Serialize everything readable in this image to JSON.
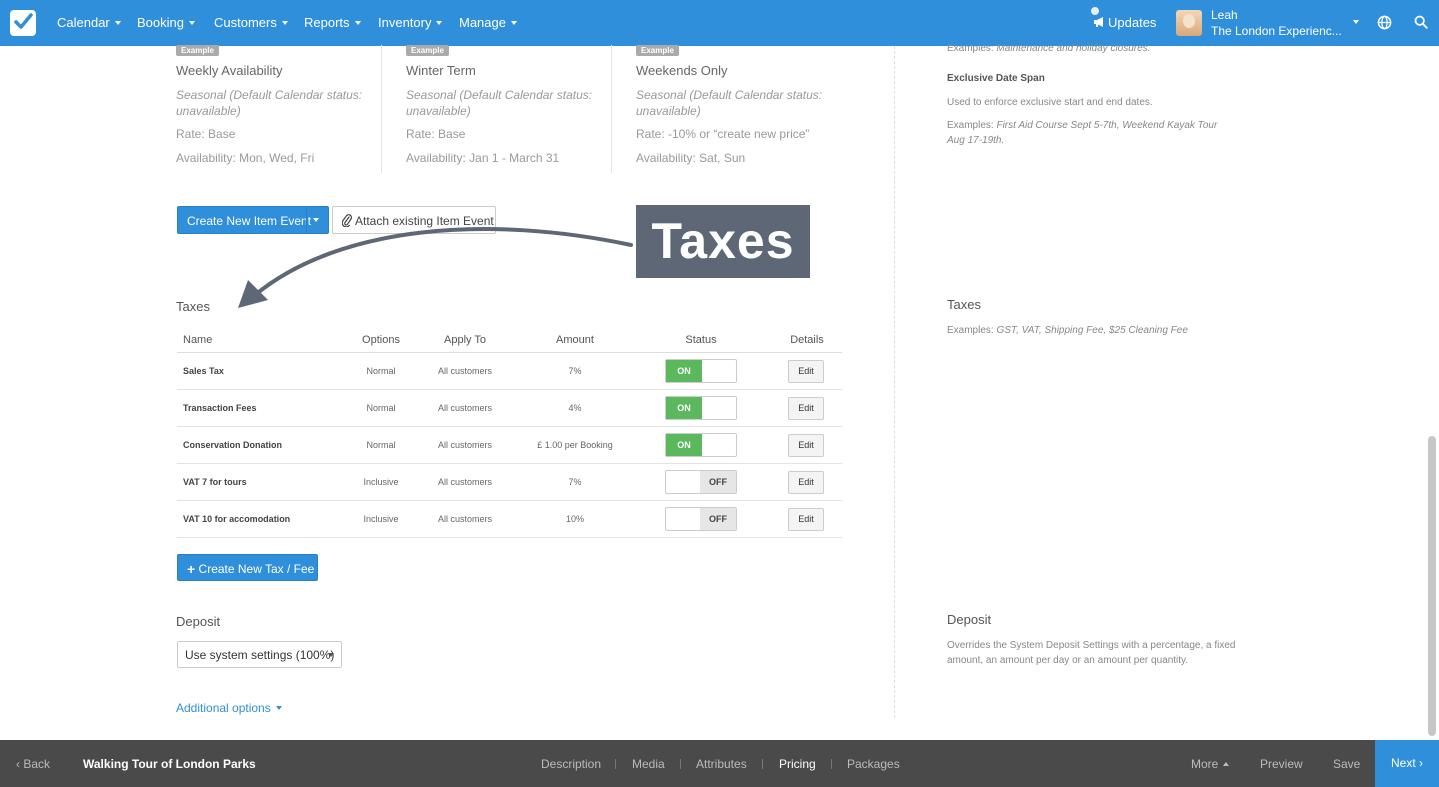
{
  "nav": {
    "items": [
      {
        "label": "Calendar"
      },
      {
        "label": "Booking"
      },
      {
        "label": "Customers"
      },
      {
        "label": "Reports"
      },
      {
        "label": "Inventory"
      },
      {
        "label": "Manage"
      }
    ],
    "updates_label": "Updates",
    "user_name": "Leah",
    "user_org": "The London Experienc..."
  },
  "examples": [
    {
      "badge": "Example",
      "title": "Weekly Availability",
      "status": "Seasonal (Default Calendar status: unavailable)",
      "rate": "Rate: Base",
      "availability": "Availability: Mon, Wed, Fri"
    },
    {
      "badge": "Example",
      "title": "Winter Term",
      "status": "Seasonal (Default Calendar status: unavailable)",
      "rate": "Rate: Base",
      "availability": "Availability: Jan 1 - March 31"
    },
    {
      "badge": "Example",
      "title": "Weekends Only",
      "status": "Seasonal (Default Calendar status: unavailable)",
      "rate": "Rate: -10% or “create new price”",
      "availability": "Availability: Sat, Sun"
    }
  ],
  "actions": {
    "create_item_event": "Create New Item Event",
    "attach_item_event": "Attach existing Item Event"
  },
  "callout": "Taxes",
  "taxes": {
    "title": "Taxes",
    "headers": {
      "name": "Name",
      "options": "Options",
      "apply_to": "Apply To",
      "amount": "Amount",
      "status": "Status",
      "details": "Details"
    },
    "rows": [
      {
        "name": "Sales Tax",
        "options": "Normal",
        "apply_to": "All customers",
        "amount": "7%",
        "status": "ON",
        "edit": "Edit"
      },
      {
        "name": "Transaction Fees",
        "options": "Normal",
        "apply_to": "All customers",
        "amount": "4%",
        "status": "ON",
        "edit": "Edit"
      },
      {
        "name": "Conservation Donation",
        "options": "Normal",
        "apply_to": "All customers",
        "amount": "£ 1.00 per Booking",
        "status": "ON",
        "edit": "Edit"
      },
      {
        "name": "VAT 7 for tours",
        "options": "Inclusive",
        "apply_to": "All customers",
        "amount": "7%",
        "status": "OFF",
        "edit": "Edit"
      },
      {
        "name": "VAT 10 for accomodation",
        "options": "Inclusive",
        "apply_to": "All customers",
        "amount": "10%",
        "status": "OFF",
        "edit": "Edit"
      }
    ],
    "create_button": "Create New Tax / Fee"
  },
  "deposit": {
    "title": "Deposit",
    "selected": "Use system settings (100%)"
  },
  "additional_options": "Additional options",
  "right": {
    "closures_examples_prefix": "Examples: ",
    "closures_examples": "Maintenance and holiday closures.",
    "exclusive_title": "Exclusive Date Span",
    "exclusive_desc": "Used to enforce exclusive start and end dates.",
    "exclusive_examples_prefix": "Examples: ",
    "exclusive_examples": "First Aid Course Sept 5-7th, Weekend Kayak Tour Aug 17-19th.",
    "taxes_title": "Taxes",
    "taxes_examples_prefix": "Examples: ",
    "taxes_examples": "GST, VAT, Shipping Fee, $25 Cleaning Fee",
    "deposit_title": "Deposit",
    "deposit_desc": "Overrides the System Deposit Settings with a percentage, a fixed amount, an amount per day or an amount per quantity."
  },
  "bottom": {
    "back": "Back",
    "item_title": "Walking Tour of London Parks",
    "tabs": [
      {
        "label": "Description"
      },
      {
        "label": "Media"
      },
      {
        "label": "Attributes"
      },
      {
        "label": "Pricing"
      },
      {
        "label": "Packages"
      }
    ],
    "more": "More",
    "preview": "Preview",
    "save": "Save",
    "next": "Next"
  },
  "colors": {
    "brand": "#2f8fdb",
    "on": "#5cb85c",
    "bottom_bar": "#4a4a4a",
    "callout": "#5d6776"
  }
}
